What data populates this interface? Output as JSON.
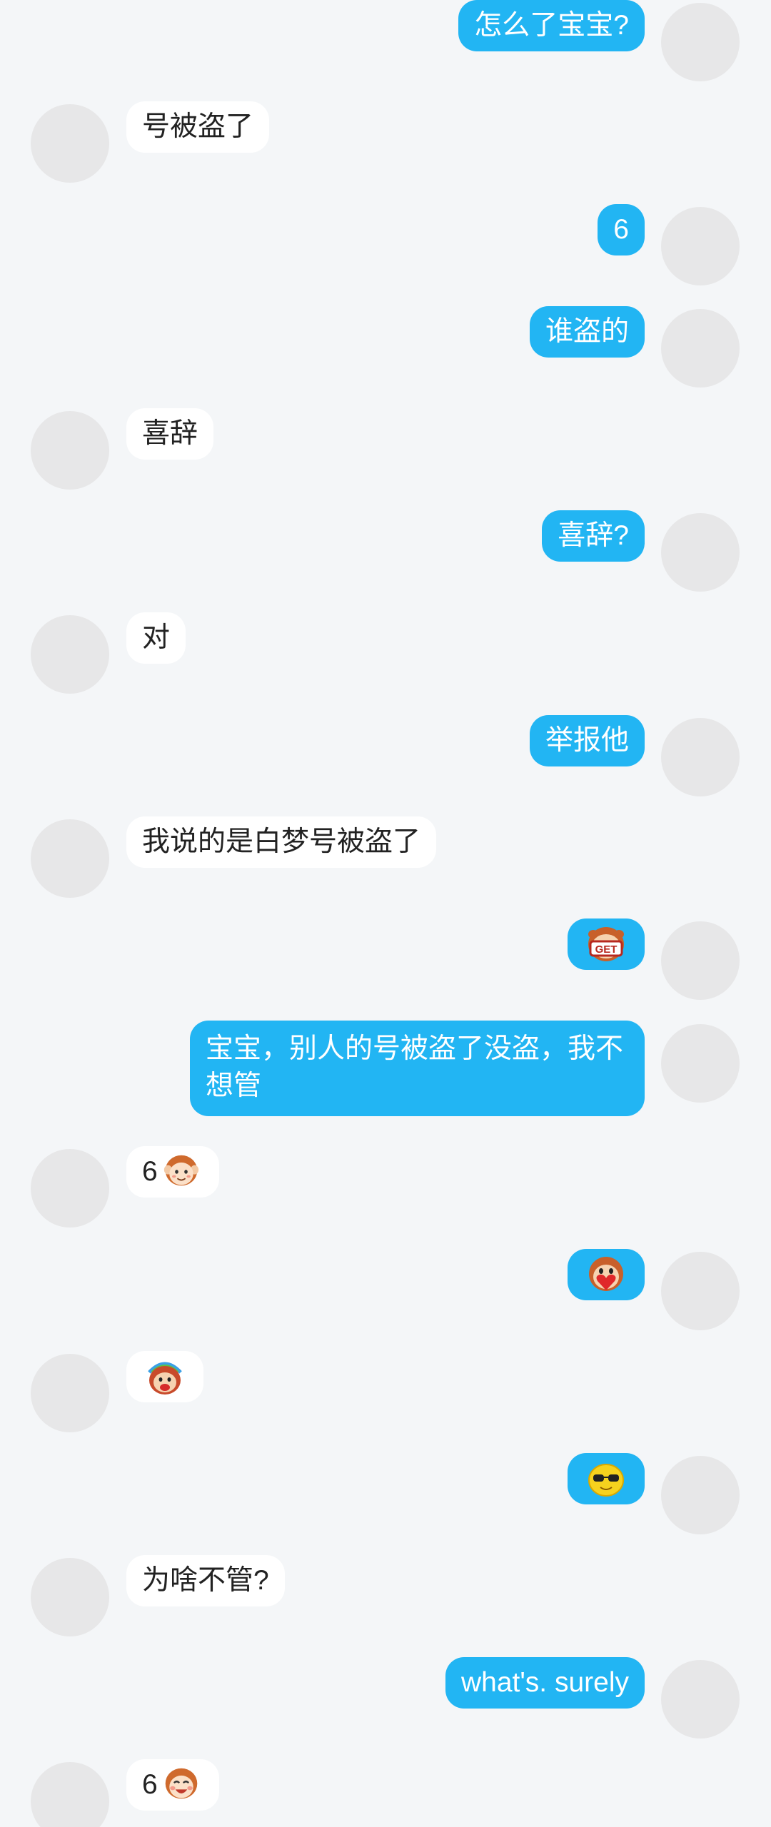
{
  "messages": [
    {
      "id": "m1",
      "side": "right",
      "text": "怎么了宝宝?"
    },
    {
      "id": "m2",
      "side": "left",
      "text": "号被盗了"
    },
    {
      "id": "m3",
      "side": "right",
      "text": "6"
    },
    {
      "id": "m4",
      "side": "right",
      "text": "谁盗的"
    },
    {
      "id": "m5",
      "side": "left",
      "text": "喜辞"
    },
    {
      "id": "m6",
      "side": "right",
      "text": "喜辞?"
    },
    {
      "id": "m7",
      "side": "left",
      "text": "对"
    },
    {
      "id": "m8",
      "side": "right",
      "text": "举报他"
    },
    {
      "id": "m9",
      "side": "left",
      "text": "我说的是白梦号被盗了"
    },
    {
      "id": "m10",
      "side": "right",
      "sticker": "monkey-get-emoji",
      "sticker_text": "GET"
    },
    {
      "id": "m11",
      "side": "right",
      "text": "宝宝，别人的号被盗了没盗，我不想管"
    },
    {
      "id": "m12",
      "side": "left",
      "text": "6",
      "sticker": "monkey-smile-emoji"
    },
    {
      "id": "m13",
      "side": "right",
      "sticker": "monkey-heart-emoji"
    },
    {
      "id": "m14",
      "side": "left",
      "sticker": "monkey-rainbow-emoji"
    },
    {
      "id": "m15",
      "side": "right",
      "sticker": "yellow-sunglasses-emoji"
    },
    {
      "id": "m16",
      "side": "left",
      "text": "为啥不管?"
    },
    {
      "id": "m17",
      "side": "right",
      "text": "what's. surely"
    },
    {
      "id": "m18",
      "side": "left",
      "text": "6",
      "sticker": "monkey-laugh-emoji"
    }
  ],
  "colors": {
    "background": "#f4f6f8",
    "outgoing_bubble": "#22b5f3",
    "incoming_bubble": "#ffffff",
    "avatar_placeholder": "#e7e7e8"
  }
}
